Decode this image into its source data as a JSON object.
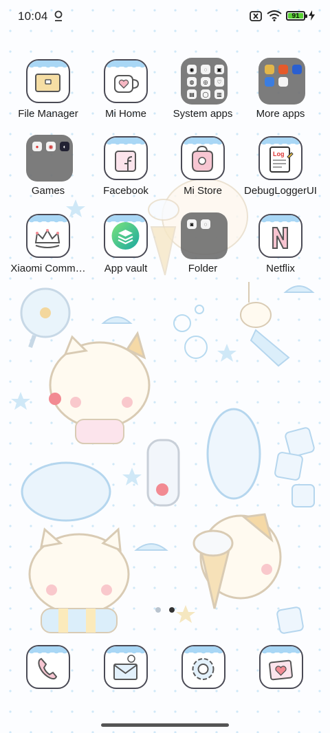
{
  "status_bar": {
    "time": "10:04",
    "icons": [
      "signal-off-icon",
      "wifi-icon",
      "battery-icon",
      "charging-icon"
    ],
    "battery_level": "91"
  },
  "apps": [
    {
      "label": "File Manager",
      "icon": "folder-icon"
    },
    {
      "label": "Mi Home",
      "icon": "mug-heart-icon"
    },
    {
      "label": "System apps",
      "icon": "folder-group-icon",
      "folder": true
    },
    {
      "label": "More apps",
      "icon": "folder-group-icon",
      "folder": true
    },
    {
      "label": "Games",
      "icon": "folder-group-icon",
      "folder": true
    },
    {
      "label": "Facebook",
      "icon": "facebook-icon"
    },
    {
      "label": "Mi Store",
      "icon": "shopping-bag-icon"
    },
    {
      "label": "DebugLoggerUI",
      "icon": "log-notepad-icon"
    },
    {
      "label": "Xiaomi Comm…",
      "icon": "crown-icon"
    },
    {
      "label": "App vault",
      "icon": "stack-layers-icon"
    },
    {
      "label": "Folder",
      "icon": "folder-group-icon",
      "folder": true
    },
    {
      "label": "Netflix",
      "icon": "netflix-n-icon"
    }
  ],
  "page_indicator": {
    "pages": 2,
    "current": 2
  },
  "dock": [
    {
      "name": "phone",
      "icon": "phone-icon"
    },
    {
      "name": "messages",
      "icon": "envelope-icon"
    },
    {
      "name": "settings",
      "icon": "gear-icon"
    },
    {
      "name": "gallery",
      "icon": "photo-heart-icon"
    }
  ],
  "colors": {
    "accent": "#a9d7f5",
    "battery": "#5ad234",
    "icon_border": "#4a4a55"
  }
}
